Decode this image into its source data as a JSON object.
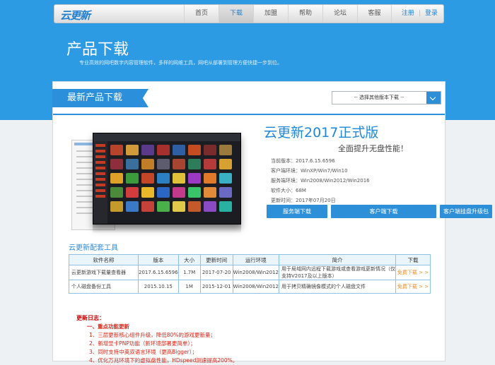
{
  "nav": {
    "logo": "云更新",
    "items": [
      {
        "label": "首页",
        "active": false
      },
      {
        "label": "下载",
        "active": true
      },
      {
        "label": "加盟",
        "active": false
      },
      {
        "label": "帮助",
        "active": false
      },
      {
        "label": "论坛",
        "active": false
      },
      {
        "label": "客服",
        "active": false
      }
    ],
    "register": "注册",
    "separator": "|",
    "login": "登录"
  },
  "hero": {
    "title": "产品下载",
    "subtitle": "专业高效的网吧数字内容管理软件，多样的网维工具，网吧从部署到管理方便快捷一步到位。"
  },
  "section": {
    "ribbon": "最新产品下载",
    "version_select": "-- 选择其他版本下载 --"
  },
  "product": {
    "title": "云更新2017正式版",
    "slogan": "全面提升无盘性能！",
    "specs": [
      "当前版本：2017.6.15.6596",
      "客户端环境：WinXP/Win7/Win10",
      "服务端环境：Win2008/Win2012/Win2016",
      "软件大小：68M",
      "更新时间：2017年07月20日"
    ],
    "buttons": [
      "服务端下载",
      "客户端下载",
      "客户端挂盘升级包"
    ]
  },
  "tools": {
    "title": "云更新配套工具",
    "headers": [
      "软件名称",
      "版本",
      "大小",
      "更新时间",
      "运行环境",
      "简介",
      "下载"
    ],
    "rows": [
      [
        "云更新游戏下载量查看器",
        "2017.6.15.6596",
        "1.7M",
        "2017-07-20",
        "Win2008/Win2012",
        "用于局域网内远程下载游戏或查看游戏更新情况（仅支持V2017及以上版本）",
        "免费下载 > >"
      ],
      [
        "个人磁盘备份工具",
        "2015.10.15",
        "1M",
        "2015-12-01",
        "Win2008/Win2012",
        "用于拷贝精确镜像模式的个人磁盘文件",
        "免费下载 > >"
      ]
    ]
  },
  "changelog": {
    "title": "更新日志：",
    "subtitle": "一、重点功能更新",
    "items": [
      "1、三层更新核心组件升级，降低80%的游戏更新量；",
      "2、新增显卡PNP功能（新环境部署更简单）；",
      "3、同时支持中英双语言环境（更高Bigger）；",
      "4、优化万兆环境下的虚拟盘性能，HDspeed测速提高200%。"
    ]
  },
  "colors": {
    "hero_blue": "#2c9be3",
    "accent_blue": "#2b8fdc",
    "link_orange": "#f08a1c",
    "changelog_red": "#d21"
  }
}
